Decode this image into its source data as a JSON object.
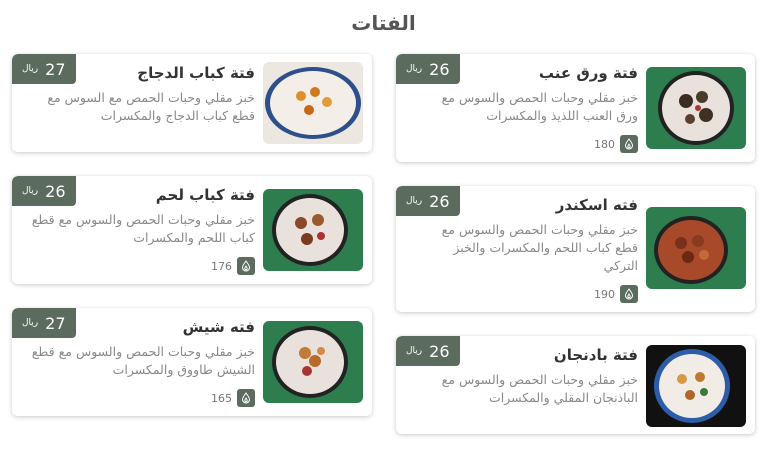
{
  "section": {
    "title": "الفتات"
  },
  "currency": "ريال",
  "items": [
    {
      "name": "فتة ورق عنب",
      "price": "26",
      "description": "خبز مقلي وحبات الحمص والسوس مع ورق العنب اللذيذ والمكسرات",
      "calories": "180"
    },
    {
      "name": "فته اسكندر",
      "price": "26",
      "description": "خبز مقلي وحبات الحمص والسوس مع قطع كباب اللحم والمكسرات والخبز التركي",
      "calories": "190"
    },
    {
      "name": "فتة بادنجان",
      "price": "26",
      "description": "خبز مقلي وحبات الحمص والسوس مع الباذنجان المقلي والمكسرات"
    },
    {
      "name": "فتة كباب الدجاج",
      "price": "27",
      "description": "خبز مقلي وحبات الحمص مع السوس مع قطع كباب الدجاج والمكسرات"
    },
    {
      "name": "فتة كباب لحم",
      "price": "26",
      "description": "خبز مقلي وحبات الحمص والسوس مع قطع كباب اللحم والمكسرات",
      "calories": "176"
    },
    {
      "name": "فته شيش",
      "price": "27",
      "description": "خبز مقلي وحبات الحمص والسوس مع قطع الشيش طاووق والمكسرات",
      "calories": "165"
    }
  ],
  "colors": {
    "accent": "#5b6b5d",
    "food_bg_green": "#2e7d4f"
  }
}
